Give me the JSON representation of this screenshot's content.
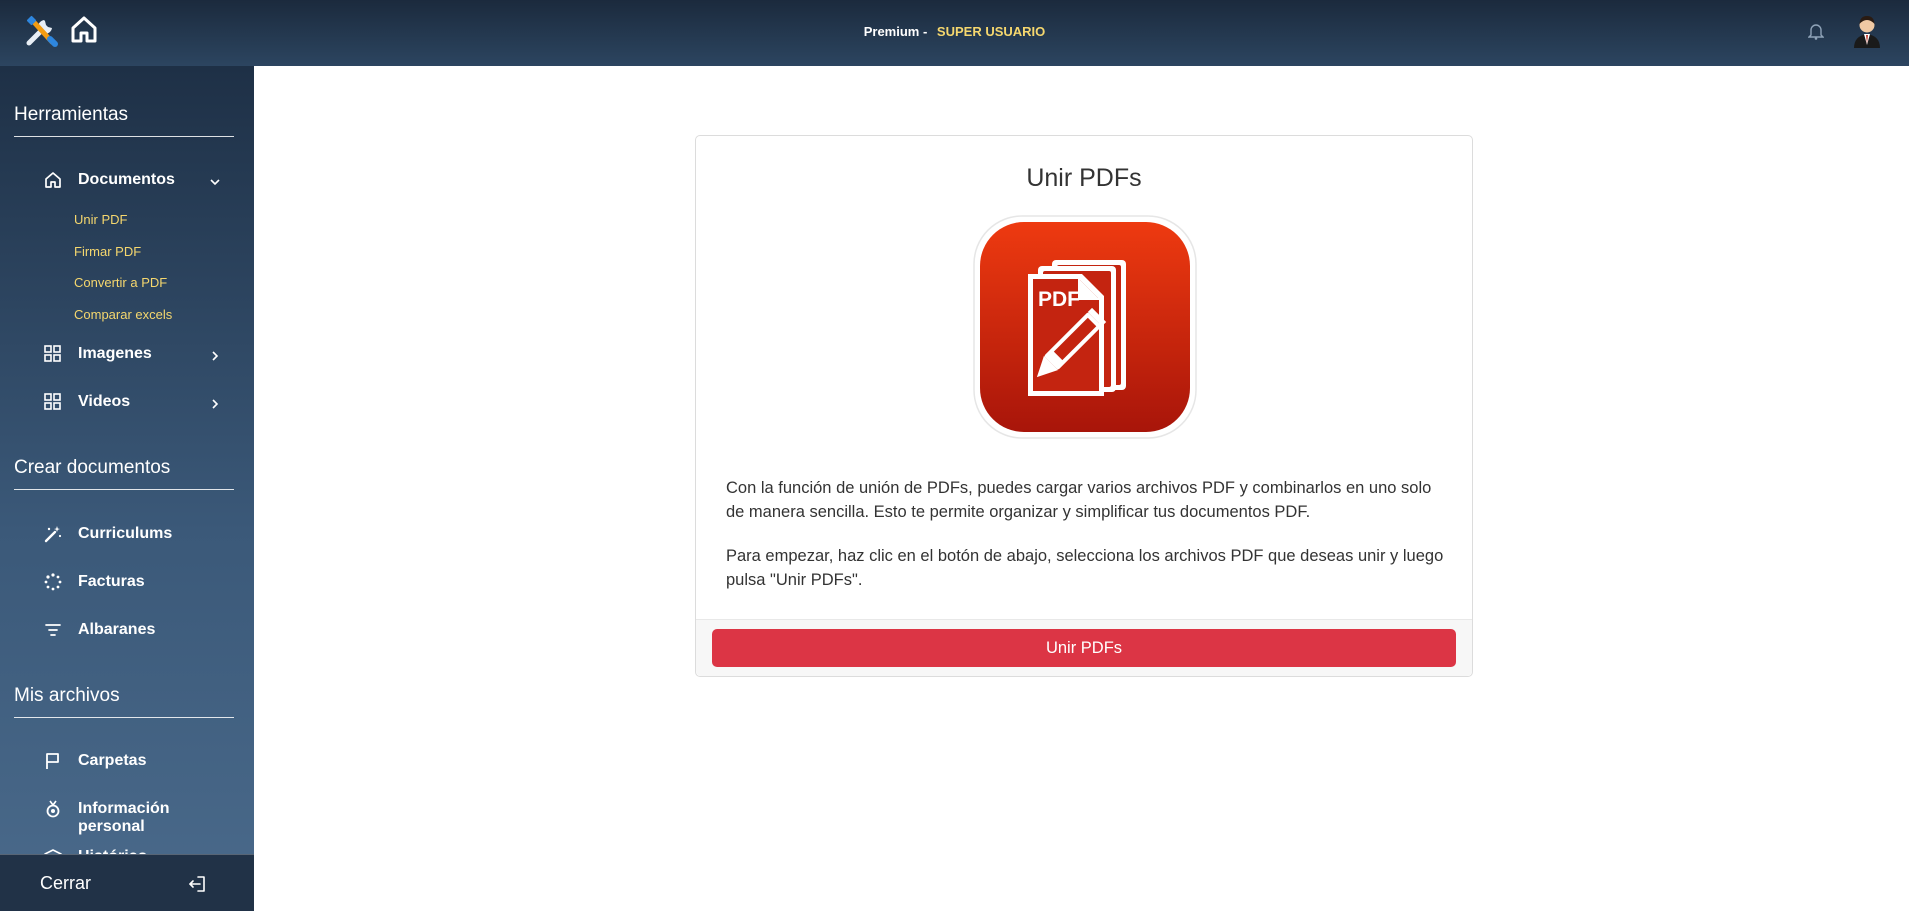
{
  "header": {
    "plan_label": "Premium -",
    "user_role": "SUPER USUARIO",
    "icons": [
      "tools-icon",
      "home-icon",
      "bell-icon",
      "user-avatar"
    ]
  },
  "sidebar": {
    "sections": [
      {
        "title": "Herramientas",
        "items": [
          {
            "label": "Documentos",
            "icon": "home-icon",
            "expanded": true,
            "subitems": [
              "Unir PDF",
              "Firmar PDF",
              "Convertir a PDF",
              "Comparar excels"
            ]
          },
          {
            "label": "Imagenes",
            "icon": "grid-icon",
            "expanded": false
          },
          {
            "label": "Videos",
            "icon": "grid-icon",
            "expanded": false
          }
        ]
      },
      {
        "title": "Crear documentos",
        "items": [
          {
            "label": "Curriculums",
            "icon": "magic-wand-icon"
          },
          {
            "label": "Facturas",
            "icon": "loader-icon"
          },
          {
            "label": "Albaranes",
            "icon": "filter-icon"
          }
        ]
      },
      {
        "title": "Mis archivos",
        "items": [
          {
            "label": "Carpetas",
            "icon": "flag-icon"
          },
          {
            "label": "Información personal",
            "icon": "badge-icon"
          },
          {
            "label": "Histórico",
            "icon": "layers-icon"
          }
        ]
      }
    ],
    "footer": {
      "logout_label": "Cerrar"
    }
  },
  "main": {
    "card": {
      "title": "Unir PDFs",
      "logo_text": "PDF",
      "paragraph1": "Con la función de unión de PDFs, puedes cargar varios archivos PDF y combinarlos en uno solo de manera sencilla. Esto te permite organizar y simplificar tus documentos PDF.",
      "paragraph2": "Para empezar, haz clic en el botón de abajo, selecciona los archivos PDF que deseas unir y luego pulsa \"Unir PDFs\".",
      "button_label": "Unir PDFs"
    }
  },
  "colors": {
    "header_bg": "#1b2a3d",
    "sidebar_bg": "#2c4560",
    "accent_yellow": "#f5d76e",
    "primary_red": "#dc3545",
    "pdf_red": "#c8230d"
  }
}
